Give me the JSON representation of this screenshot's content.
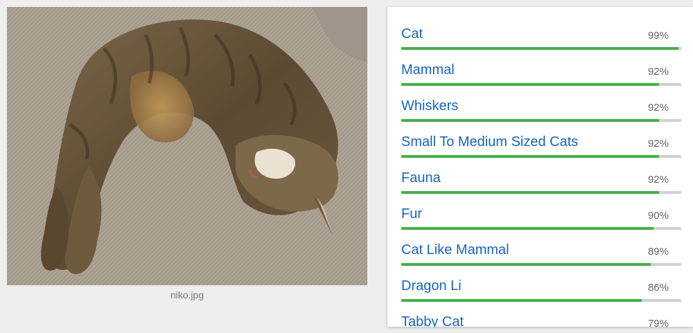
{
  "image": {
    "caption": "niko.jpg",
    "subject": "cat photo"
  },
  "labels": [
    {
      "name": "Cat",
      "score_text": "99%",
      "score": 0.99
    },
    {
      "name": "Mammal",
      "score_text": "92%",
      "score": 0.92
    },
    {
      "name": "Whiskers",
      "score_text": "92%",
      "score": 0.92
    },
    {
      "name": "Small To Medium Sized Cats",
      "score_text": "92%",
      "score": 0.92
    },
    {
      "name": "Fauna",
      "score_text": "92%",
      "score": 0.92
    },
    {
      "name": "Fur",
      "score_text": "90%",
      "score": 0.9
    },
    {
      "name": "Cat Like Mammal",
      "score_text": "89%",
      "score": 0.89
    },
    {
      "name": "Dragon Li",
      "score_text": "86%",
      "score": 0.86
    },
    {
      "name": "Tabby Cat",
      "score_text": "79%",
      "score": 0.79
    }
  ],
  "colors": {
    "label_text": "#1565c0",
    "bar_fill": "#43b047",
    "bar_track": "#d0d0d0",
    "page_background": "#eeeeee"
  }
}
